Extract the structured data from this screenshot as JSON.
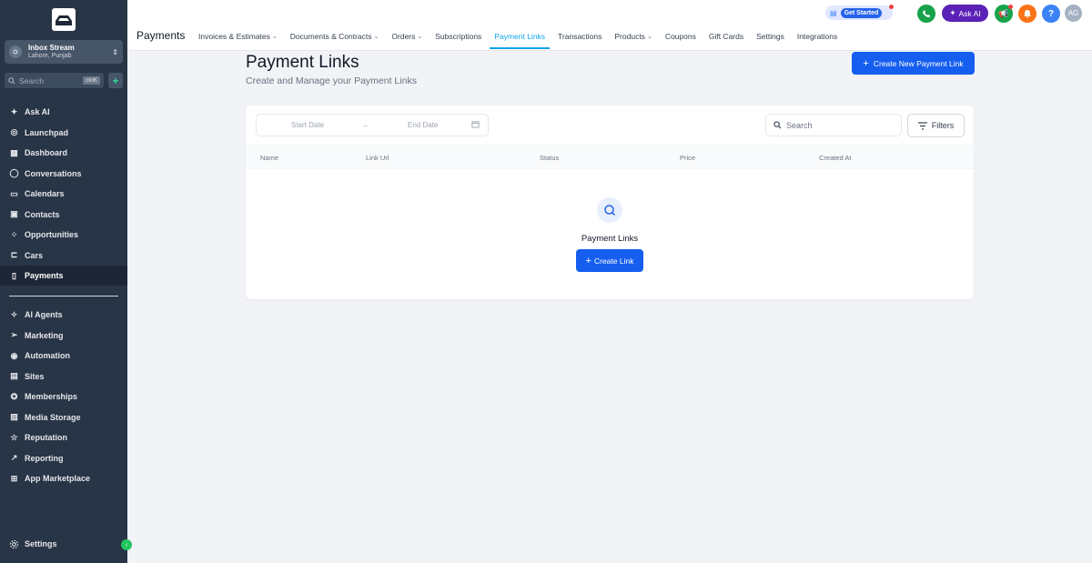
{
  "sidebar": {
    "account": {
      "name": "Inbox Stream",
      "location": "Lahore, Punjab"
    },
    "search": {
      "placeholder": "Search",
      "shortcut": "ctrlK"
    },
    "items": [
      {
        "label": "Ask AI",
        "icon": "sparkle-icon"
      },
      {
        "label": "Launchpad",
        "icon": "rocket-icon"
      },
      {
        "label": "Dashboard",
        "icon": "grid-icon"
      },
      {
        "label": "Conversations",
        "icon": "chat-icon"
      },
      {
        "label": "Calendars",
        "icon": "calendar-icon"
      },
      {
        "label": "Contacts",
        "icon": "contacts-icon"
      },
      {
        "label": "Opportunities",
        "icon": "opportunities-icon"
      },
      {
        "label": "Cars",
        "icon": "car-icon"
      },
      {
        "label": "Payments",
        "icon": "receipt-icon",
        "active": true
      }
    ],
    "items2": [
      {
        "label": "AI Agents",
        "icon": "ai-agents-icon"
      },
      {
        "label": "Marketing",
        "icon": "send-icon"
      },
      {
        "label": "Automation",
        "icon": "automation-icon"
      },
      {
        "label": "Sites",
        "icon": "sites-icon"
      },
      {
        "label": "Memberships",
        "icon": "badge-icon"
      },
      {
        "label": "Media Storage",
        "icon": "image-icon"
      },
      {
        "label": "Reputation",
        "icon": "star-icon"
      },
      {
        "label": "Reporting",
        "icon": "chart-icon"
      },
      {
        "label": "App Marketplace",
        "icon": "apps-icon"
      }
    ],
    "settings": "Settings"
  },
  "header": {
    "title": "Payments",
    "tabs": [
      {
        "label": "Invoices & Estimates",
        "dropdown": true
      },
      {
        "label": "Documents & Contracts",
        "dropdown": true
      },
      {
        "label": "Orders",
        "dropdown": true
      },
      {
        "label": "Subscriptions"
      },
      {
        "label": "Payment Links",
        "active": true
      },
      {
        "label": "Transactions"
      },
      {
        "label": "Products",
        "dropdown": true
      },
      {
        "label": "Coupons"
      },
      {
        "label": "Gift Cards"
      },
      {
        "label": "Settings"
      },
      {
        "label": "Integrations"
      }
    ],
    "get_started": "Get Started",
    "ask_ai": "Ask AI",
    "help": "?",
    "avatar": "AG"
  },
  "main": {
    "title": "Payment Links",
    "subtitle": "Create and Manage your Payment Links",
    "create_button": "Create New Payment Link",
    "date_start_placeholder": "Start Date",
    "date_end_placeholder": "End Date",
    "search_placeholder": "Search",
    "filters_label": "Filters",
    "columns": [
      "Name",
      "Link Url",
      "Status",
      "Price",
      "Created At"
    ],
    "empty_title": "Payment Links",
    "empty_button": "Create Link"
  },
  "colors": {
    "sidebar_bg": "#283547",
    "primary": "#155eef",
    "active_tab": "#0ea5e9",
    "ask_ai": "#5b21b6"
  }
}
